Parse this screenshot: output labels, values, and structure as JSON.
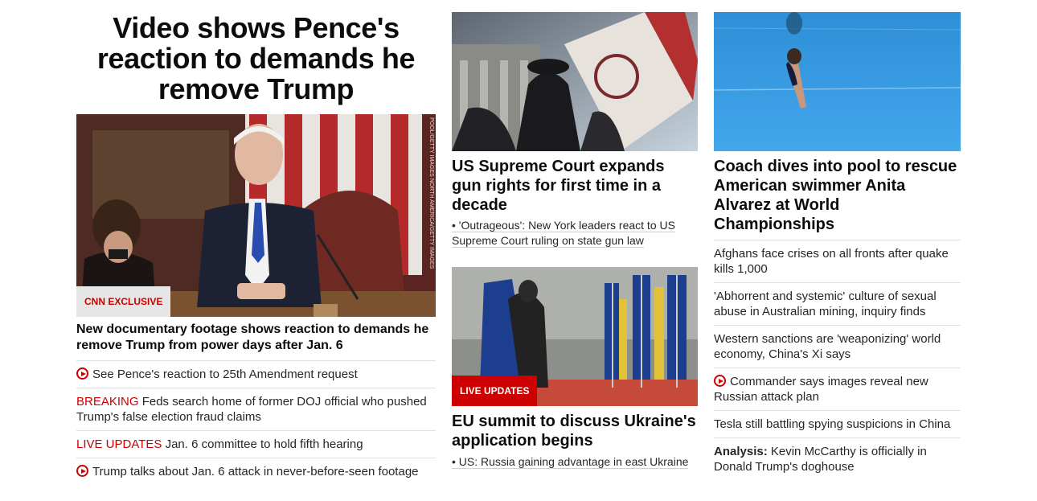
{
  "col1": {
    "headline": "Video shows Pence's reaction to demands he remove Trump",
    "badge": "CNN EXCLUSIVE",
    "photo_credit": "POOL/GETTY IMAGES NORTH AMERICA/GETTY IMAGES",
    "title": "New documentary footage shows reaction to demands he remove Trump from power days after Jan. 6",
    "items": [
      {
        "prefix": "",
        "text": "See Pence's reaction to 25th Amendment request",
        "video": true
      },
      {
        "prefix": "BREAKING",
        "text": "Feds search home of former DOJ official who pushed Trump's false election fraud claims",
        "video": false
      },
      {
        "prefix": "LIVE UPDATES",
        "text": "Jan. 6 committee to hold fifth hearing",
        "video": false
      },
      {
        "prefix": "",
        "text": "Trump talks about Jan. 6 attack in never-before-seen footage",
        "video": true
      }
    ]
  },
  "col2": {
    "card1": {
      "title": "US Supreme Court expands gun rights for first time in a decade",
      "sub": "• 'Outrageous': New York leaders react to US Supreme Court ruling on state gun law"
    },
    "card2": {
      "badge": "LIVE UPDATES",
      "title": "EU summit to discuss Ukraine's application begins",
      "sub": "• US: Russia gaining advantage in east Ukraine"
    }
  },
  "col3": {
    "title": "Coach dives into pool to rescue American swimmer Anita Alvarez at World Championships",
    "items": [
      {
        "prefix": "",
        "text": "Afghans face crises on all fronts after quake kills 1,000",
        "video": false
      },
      {
        "prefix": "",
        "text": "'Abhorrent and systemic' culture of sexual abuse in Australian mining, inquiry finds",
        "video": false
      },
      {
        "prefix": "",
        "text": "Western sanctions are 'weaponizing' world economy, China's Xi says",
        "video": false
      },
      {
        "prefix": "",
        "text": "Commander says images reveal new Russian attack plan",
        "video": true
      },
      {
        "prefix": "",
        "text": "Tesla still battling spying suspicions in China",
        "video": false
      },
      {
        "prefix": "Analysis:",
        "text": "Kevin McCarthy is officially in Donald Trump's doghouse",
        "video": false
      }
    ]
  },
  "colors": {
    "accent": "#cc0000",
    "text": "#0c0c0c",
    "divider": "#e0e0e0"
  }
}
